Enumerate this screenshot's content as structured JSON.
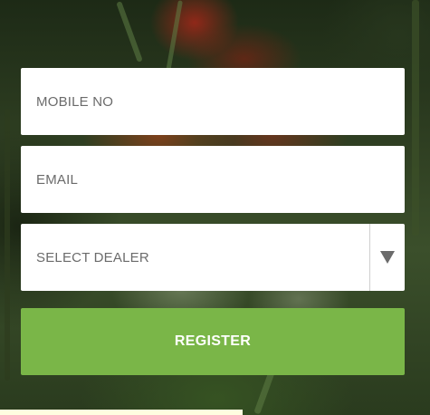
{
  "form": {
    "mobile_placeholder": "MOBILE NO",
    "email_placeholder": "EMAIL",
    "dealer_select": {
      "selected": "SELECT DEALER",
      "icon": "triangle-down-icon"
    },
    "register_label": "REGISTER"
  },
  "colors": {
    "register_button": "#7ab648",
    "field_background": "#ffffff",
    "placeholder_text": "#6b6b6b"
  }
}
